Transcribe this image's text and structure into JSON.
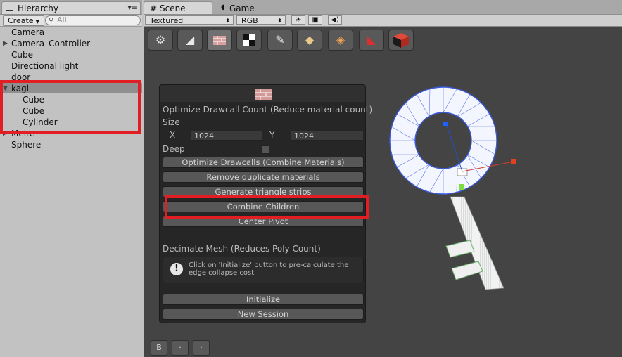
{
  "hierarchy": {
    "tab_title": "Hierarchy",
    "create_label": "Create",
    "search_placeholder": "All",
    "items": [
      {
        "label": "Camera"
      },
      {
        "label": "Camera_Controller"
      },
      {
        "label": "Cube"
      },
      {
        "label": "Directional light"
      },
      {
        "label": "door"
      },
      {
        "label": "kagi"
      },
      {
        "label": "Cube"
      },
      {
        "label": "Cube"
      },
      {
        "label": "Cylinder"
      },
      {
        "label": "Meire"
      },
      {
        "label": "Sphere"
      }
    ]
  },
  "scene": {
    "tabs": [
      {
        "label": "Scene"
      },
      {
        "label": "Game"
      }
    ],
    "render_mode": "Textured",
    "color_mode": "RGB"
  },
  "optimizer": {
    "heading": "Optimize Drawcall Count (Reduce material count)",
    "size_label": "Size",
    "x_label": "X",
    "x_value": "1024",
    "y_label": "Y",
    "y_value": "1024",
    "deep_label": "Deep",
    "buttons": [
      "Optimize Drawcalls (Combine Materials)",
      "Remove duplicate materials",
      "Generate triangle strips",
      "Combine Children",
      "Center Pivot"
    ],
    "decimate_heading": "Decimate Mesh (Reduces Poly Count)",
    "help_text": "Click on 'Initialize' button to pre-calculate the edge collapse cost",
    "initialize_label": "Initialize",
    "new_session_label": "New Session"
  },
  "bottom_buttons": [
    "B",
    "·",
    "·"
  ],
  "icons": [
    "gear-icon",
    "pyramid-icon",
    "brick-icon",
    "checker-icon",
    "brush-icon",
    "eraser-icon",
    "box-icon",
    "paint-bucket-icon",
    "cube-icon"
  ],
  "colors": {
    "highlight_red": "#e21e25",
    "panel_dark": "#262626",
    "scene_bg": "#444444"
  }
}
